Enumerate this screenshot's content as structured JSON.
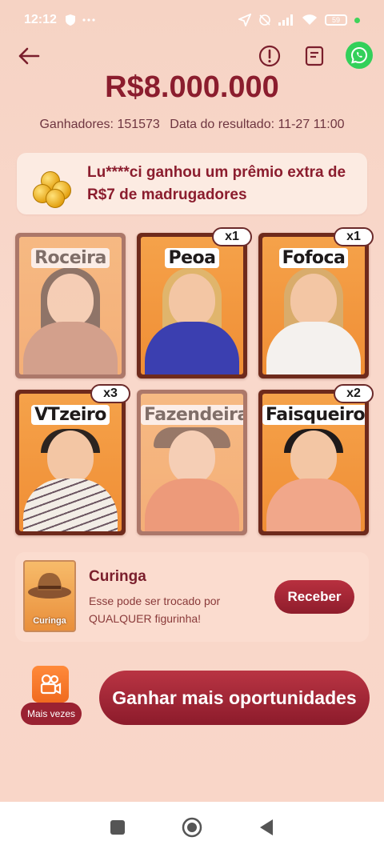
{
  "status_bar": {
    "time": "12:12",
    "battery": "59"
  },
  "header": {
    "back_icon": "arrow-left-icon",
    "info_icon": "exclamation-circle-icon",
    "notes_icon": "document-icon",
    "whatsapp_icon": "whatsapp-icon"
  },
  "prize": {
    "amount": "R$8.000.000",
    "winners_label": "Ganhadores: 151573",
    "result_date_label": "Data do resultado: 11-27 11:00"
  },
  "banner": {
    "text": "Lu****ci ganhou um prêmio extra de R$7 de madrugadores"
  },
  "cards": [
    {
      "label": "Roceira",
      "count": "",
      "dim": true
    },
    {
      "label": "Peoa",
      "count": "x1",
      "dim": false
    },
    {
      "label": "Fofoca",
      "count": "x1",
      "dim": false
    },
    {
      "label": "VTzeiro",
      "count": "x3",
      "dim": false
    },
    {
      "label": "Fazendeira",
      "count": "",
      "dim": true
    },
    {
      "label": "Faisqueiro",
      "count": "x2",
      "dim": false
    }
  ],
  "joker": {
    "card_label": "Curinga",
    "title": "Curinga",
    "description": "Esse pode ser trocado por QUALQUER figurinha!",
    "button_label": "Receber"
  },
  "more_times": {
    "label": "Mais vezes"
  },
  "cta": {
    "label": "Ganhar mais oportunidades"
  },
  "colors": {
    "accent": "#8b1d2e",
    "background": "#f8d6c8",
    "card_orange": "#f08e35"
  }
}
